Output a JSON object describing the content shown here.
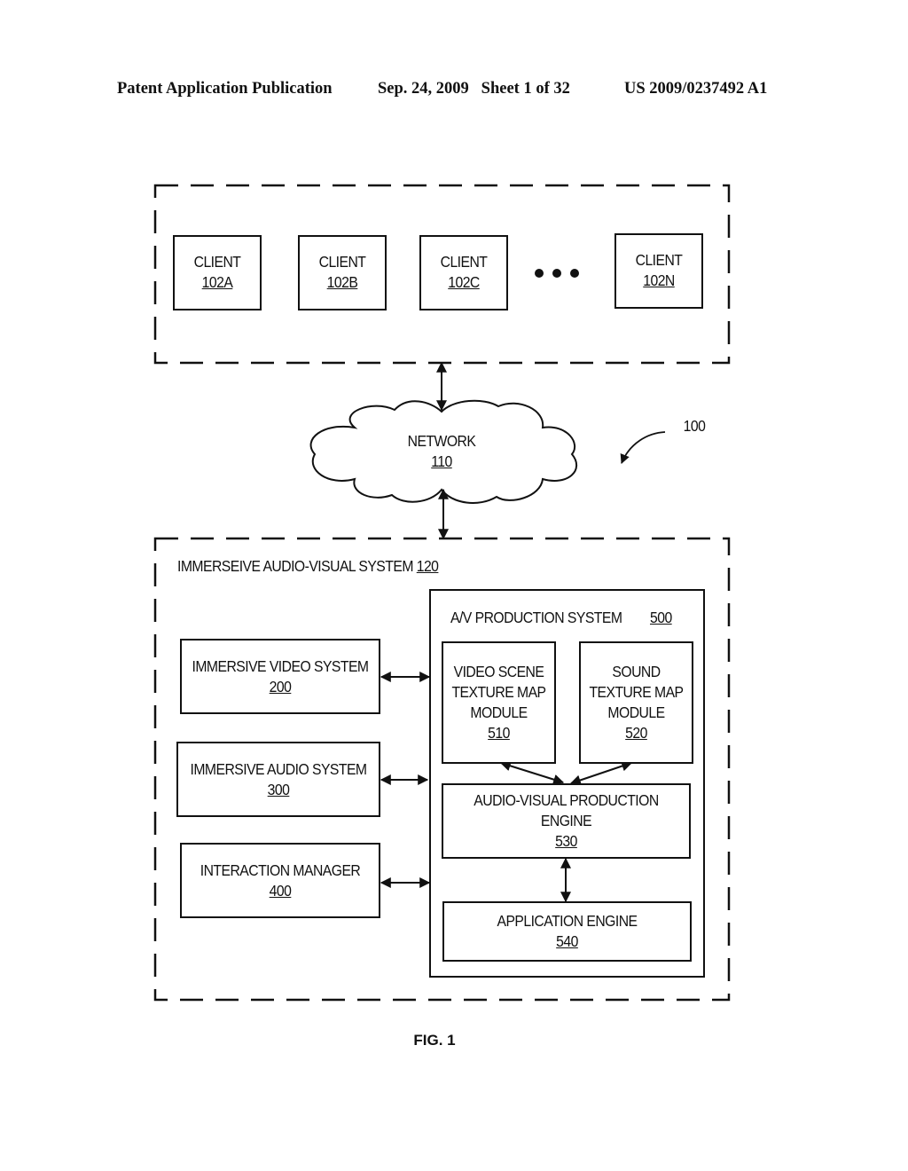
{
  "header": {
    "publication": "Patent Application Publication",
    "date_sheet": "Sep. 24, 2009   Sheet 1 of 32",
    "patent_number": "US 2009/0237492 A1"
  },
  "diagram": {
    "system_ref": "100",
    "clients": [
      {
        "label": "CLIENT",
        "ref": "102A"
      },
      {
        "label": "CLIENT",
        "ref": "102B"
      },
      {
        "label": "CLIENT",
        "ref": "102C"
      },
      {
        "label": "CLIENT",
        "ref": "102N"
      }
    ],
    "ellipsis": "•••",
    "network": {
      "label": "NETWORK",
      "ref": "110"
    },
    "av_system": {
      "label": "IMMERSEIVE AUDIO-VISUAL SYSTEM ",
      "ref": "120"
    },
    "subsystems": [
      {
        "label": "IMMERSIVE VIDEO SYSTEM",
        "ref": "200"
      },
      {
        "label": "IMMERSIVE AUDIO SYSTEM",
        "ref": "300"
      },
      {
        "label": "INTERACTION MANAGER",
        "ref": "400"
      }
    ],
    "production_system": {
      "label": "A/V PRODUCTION SYSTEM",
      "ref": "500"
    },
    "modules": {
      "video_scene": {
        "lines": [
          "VIDEO SCENE",
          "TEXTURE MAP",
          "MODULE"
        ],
        "ref": "510"
      },
      "sound": {
        "lines": [
          "SOUND",
          "TEXTURE MAP",
          "MODULE"
        ],
        "ref": "520"
      },
      "av_engine": {
        "lines": [
          "AUDIO-VISUAL PRODUCTION",
          "ENGINE"
        ],
        "ref": "530"
      },
      "app_engine": {
        "lines": [
          "APPLICATION ENGINE"
        ],
        "ref": "540"
      }
    },
    "figure_caption": "FIG. 1"
  }
}
